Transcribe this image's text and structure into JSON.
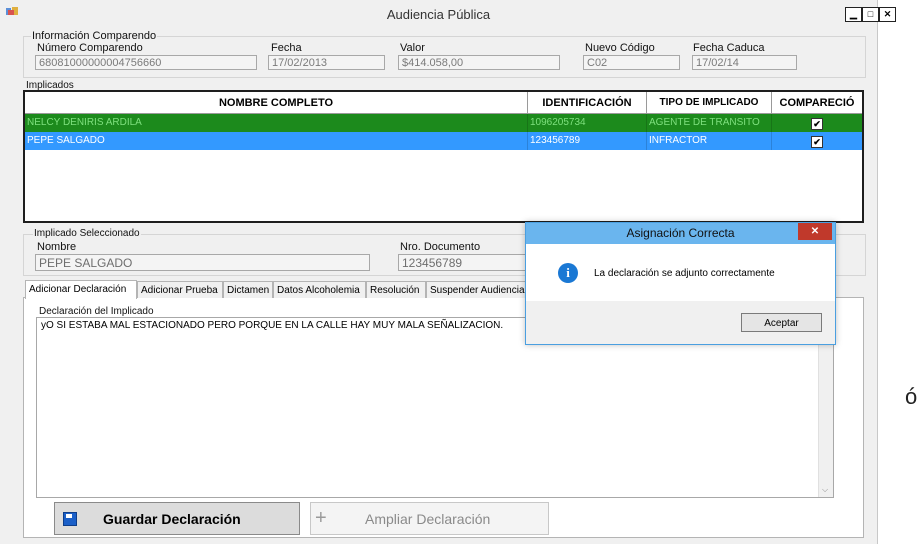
{
  "window": {
    "title": "Audiencia Pública",
    "controls": [
      "▁",
      "□",
      "✕"
    ]
  },
  "comparendo": {
    "group_label": "Información Comparendo",
    "numero_label": "Número Comparendo",
    "numero_value": "68081000000004756660",
    "fecha_label": "Fecha",
    "fecha_value": "17/02/2013",
    "valor_label": "Valor",
    "valor_value": "$414.058,00",
    "nuevo_codigo_label": "Nuevo Código",
    "nuevo_codigo_value": "C02",
    "fecha_caduca_label": "Fecha Caduca",
    "fecha_caduca_value": "17/02/14"
  },
  "implicados": {
    "group_label": "Implicados",
    "columns": [
      "NOMBRE COMPLETO",
      "IDENTIFICACIÓN",
      "TIPO DE IMPLICADO",
      "COMPARECIÓ"
    ],
    "rows": [
      {
        "nombre": "NELCY DENIRIS ARDILA",
        "identificacion": "1096205734",
        "tipo": "AGENTE DE TRANSITO",
        "comparecio": "✔"
      },
      {
        "nombre": "PEPE SALGADO",
        "identificacion": "123456789",
        "tipo": "INFRACTOR",
        "comparecio": "✔"
      }
    ]
  },
  "seleccionado": {
    "group_label": "Implicado Seleccionado",
    "nombre_label": "Nombre",
    "nombre_value": "PEPE SALGADO",
    "documento_label": "Nro. Documento",
    "documento_value": "123456789"
  },
  "tabs": [
    "Adicionar Declaración",
    "Adicionar Prueba",
    "Dictamen",
    "Datos Alcoholemia",
    "Resolución",
    "Suspender Audiencia"
  ],
  "declaracion": {
    "label": "Declaración del Implicado",
    "text": "yO SI ESTABA MAL ESTACIONADO PERO PORQUE EN LA CALLE HAY MUY MALA SEÑALIZACION."
  },
  "buttons": {
    "guardar": "Guardar Declaración",
    "ampliar": "Ampliar Declaración"
  },
  "dialog": {
    "title": "Asignación Correcta",
    "message": "La declaración se adjunto correctamente",
    "ok": "Aceptar",
    "close": "✕",
    "info_glyph": "i"
  },
  "background_fragment": {
    "char": "ó"
  },
  "colors": {
    "row_agent": "#1c8a1c",
    "row_selected": "#3399ff",
    "dialog_close": "#c0392b",
    "info_icon": "#1a78d4"
  },
  "icons": [
    "app-icon",
    "save-icon",
    "plus-icon",
    "info-icon",
    "checkbox-checked-icon",
    "scroll-down-icon"
  ]
}
